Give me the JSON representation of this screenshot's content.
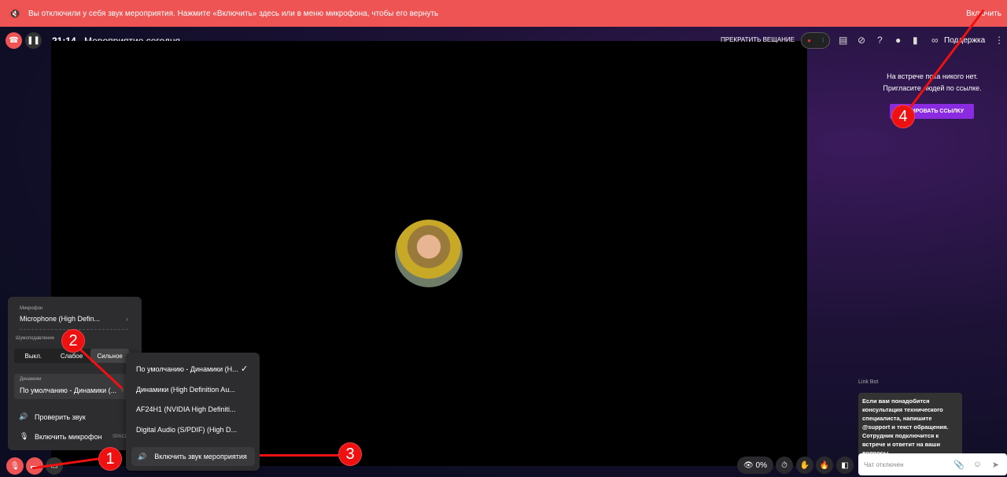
{
  "banner": {
    "message": "Вы отключили у себя звук мероприятия. Нажмите «Включить» здесь или в меню микрофона, чтобы его вернуть",
    "enable": "Включить"
  },
  "header": {
    "time": "21:14",
    "title": "Мероприятие сегодня",
    "stop_broadcast": "ПРЕКРАТИТЬ ВЕЩАНИЕ",
    "support": "Поддержка"
  },
  "side": {
    "empty_line1": "На встрече пока никого нет.",
    "empty_line2": "Пригласите людей по ссылке.",
    "copy_link": "КОПИРОВАТЬ ССЫЛКУ"
  },
  "panel": {
    "mic_label": "Микрофон",
    "mic_value": "Microphone (High Defin...",
    "noise_label": "Шумоподавление",
    "noise_options": [
      "Выкл.",
      "Слабое",
      "Сильное"
    ],
    "noise_selected": "Сильное",
    "speakers_label": "Динамики",
    "speakers_value": "По умолчанию - Динамики (...",
    "check_sound": "Проверить звук",
    "enable_mic": "Включить микрофон",
    "shortcut": "SPACE"
  },
  "submenu": {
    "items": [
      "По умолчанию - Динамики (H...",
      "Динамики (High Definition Au...",
      "AF24H1 (NVIDIA High Definiti...",
      "Digital Audio (S/PDIF) (High D..."
    ],
    "enable_event_sound": "Включить звук мероприятия"
  },
  "toolbar": {
    "viewers": "0%"
  },
  "chat": {
    "sender": "Link Bot",
    "message": "Если вам понадобится консультация технического специалиста, напишите @support и текст обращения. Сотрудник подключится к встрече и ответит на ваши вопросы.",
    "placeholder": "Чат отключен"
  },
  "annotations": [
    "1",
    "2",
    "3",
    "4"
  ],
  "colors": {
    "banner": "#ee5454",
    "accent": "#8a2be2"
  }
}
